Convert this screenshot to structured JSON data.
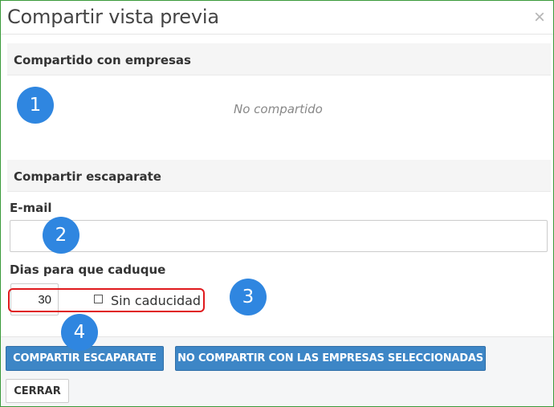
{
  "dialog": {
    "title": "Compartir vista previa",
    "close_glyph": "×"
  },
  "shared_section": {
    "heading": "Compartido con empresas",
    "empty_text": "No compartido"
  },
  "share_section": {
    "heading": "Compartir escaparate",
    "email_label": "E-mail",
    "email_value": "",
    "days_label": "Dias para que caduque",
    "days_value": "30",
    "no_expiry_label": "Sin caducidad",
    "no_expiry_checked": false
  },
  "buttons": {
    "share": "COMPARTIR ESCAPARATE",
    "unshare": "NO COMPARTIR CON LAS EMPRESAS SELECCIONADAS",
    "close": "CERRAR"
  },
  "annotations": {
    "markers": [
      "1",
      "2",
      "3",
      "4"
    ],
    "marker_color": "#2f86e0",
    "highlight_color": "#e0191d"
  },
  "colors": {
    "primary_button": "#3d86c6",
    "dialog_border": "#3a9a3a"
  }
}
